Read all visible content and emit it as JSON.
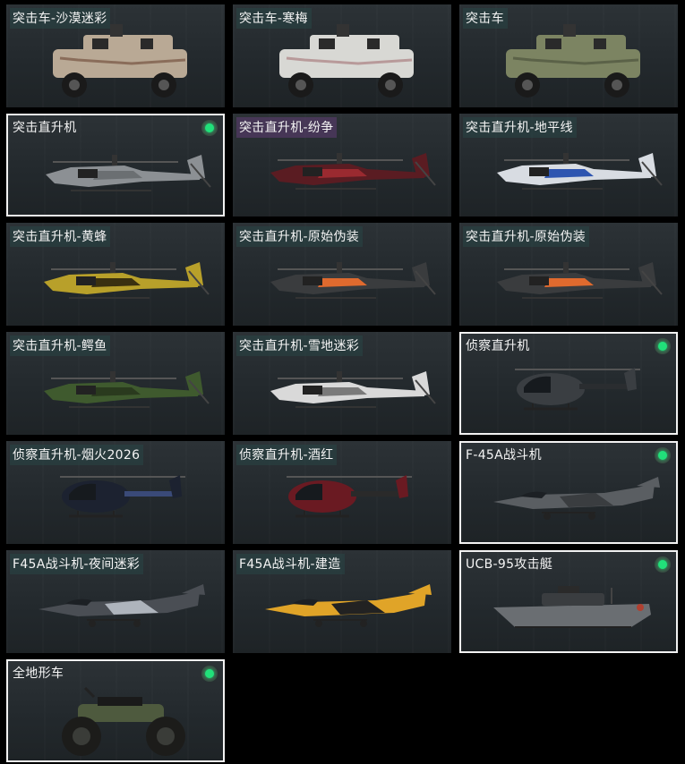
{
  "colors": {
    "selected_border": "#f2f2f2",
    "status_dot": "#21e07a",
    "label_bg": "#284646"
  },
  "cards": [
    {
      "label": "突击车-沙漠迷彩",
      "selected": false,
      "icon": "armored-car-icon",
      "body": "#b9a995",
      "accent": "#8a6d5a"
    },
    {
      "label": "突击车-寒梅",
      "selected": false,
      "icon": "armored-car-icon",
      "body": "#d8d8d4",
      "accent": "#b89a9a"
    },
    {
      "label": "突击车",
      "selected": false,
      "icon": "armored-car-icon",
      "body": "#7c8462",
      "accent": "#5b6248"
    },
    {
      "label": "突击直升机",
      "selected": true,
      "icon": "attack-helicopter-icon",
      "body": "#8c9094",
      "accent": "#6b6f72"
    },
    {
      "label": "突击直升机-纷争",
      "selected": false,
      "icon": "attack-helicopter-icon",
      "body": "#5a1c22",
      "accent": "#9a2a30",
      "label_style": "purple"
    },
    {
      "label": "突击直升机-地平线",
      "selected": false,
      "icon": "attack-helicopter-icon",
      "body": "#d8dce2",
      "accent": "#2e55b0"
    },
    {
      "label": "突击直升机-黄蜂",
      "selected": false,
      "icon": "attack-helicopter-icon",
      "body": "#b8a02a",
      "accent": "#3a3010"
    },
    {
      "label": "突击直升机-原始伪装",
      "selected": false,
      "icon": "attack-helicopter-icon",
      "body": "#3a3c3e",
      "accent": "#e06a2e"
    },
    {
      "label": "突击直升机-原始伪装",
      "selected": false,
      "icon": "attack-helicopter-icon",
      "body": "#3a3c3e",
      "accent": "#e06a2e"
    },
    {
      "label": "突击直升机-鳄鱼",
      "selected": false,
      "icon": "attack-helicopter-icon",
      "body": "#3f5a2e",
      "accent": "#2a3a1e"
    },
    {
      "label": "突击直升机-雪地迷彩",
      "selected": false,
      "icon": "attack-helicopter-icon",
      "body": "#d9d9d9",
      "accent": "#7a7a7a"
    },
    {
      "label": "侦察直升机",
      "selected": true,
      "icon": "scout-helicopter-icon",
      "body": "#3a3e42",
      "accent": "#2a2d30"
    },
    {
      "label": "侦察直升机-烟火2026",
      "selected": false,
      "icon": "scout-helicopter-icon",
      "body": "#1c2230",
      "accent": "#3a4a78"
    },
    {
      "label": "侦察直升机-酒红",
      "selected": false,
      "icon": "scout-helicopter-icon",
      "body": "#6a1a22",
      "accent": "#2a2a2a"
    },
    {
      "label": "F-45A战斗机",
      "selected": true,
      "icon": "fighter-jet-icon",
      "body": "#5a5e62",
      "accent": "#3a3d40"
    },
    {
      "label": "F45A战斗机-夜间迷彩",
      "selected": false,
      "icon": "fighter-jet-icon",
      "body": "#4a4e54",
      "accent": "#aeb4bc"
    },
    {
      "label": "F45A战斗机-建造",
      "selected": false,
      "icon": "fighter-jet-icon",
      "body": "#e0a428",
      "accent": "#222"
    },
    {
      "label": "UCB-95攻击艇",
      "selected": true,
      "icon": "attack-boat-icon",
      "body": "#6a6e72",
      "accent": "#3a3d40"
    },
    {
      "label": "全地形车",
      "selected": true,
      "icon": "atv-icon",
      "body": "#4e5a3e",
      "accent": "#2a2c2a"
    }
  ]
}
